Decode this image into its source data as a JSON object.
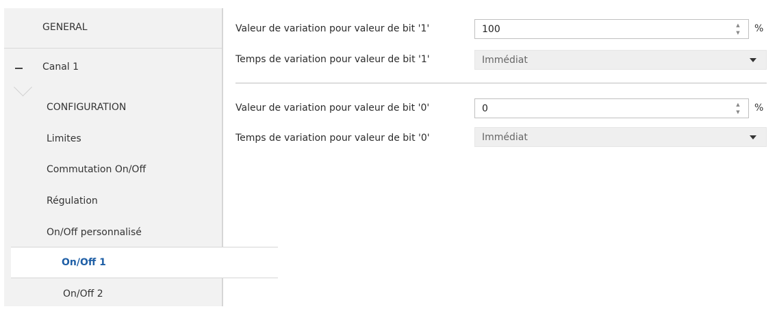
{
  "sidebar": {
    "items": [
      {
        "label": "GENERAL"
      },
      {
        "label": "Canal 1"
      },
      {
        "label": "CONFIGURATION"
      },
      {
        "label": "Limites"
      },
      {
        "label": "Commutation On/Off"
      },
      {
        "label": "Régulation"
      },
      {
        "label": "On/Off personnalisé"
      },
      {
        "label": "On/Off 1"
      },
      {
        "label": "On/Off 2"
      }
    ]
  },
  "main": {
    "bit1": {
      "value_label": "Valeur de variation pour valeur de bit '1'",
      "value": "100",
      "unit": "%",
      "time_label": "Temps de variation pour valeur de bit '1'",
      "time_value": "Immédiat"
    },
    "bit0": {
      "value_label": "Valeur de variation pour valeur de bit '0'",
      "value": "0",
      "unit": "%",
      "time_label": "Temps de variation pour valeur de bit '0'",
      "time_value": "Immédiat"
    }
  }
}
